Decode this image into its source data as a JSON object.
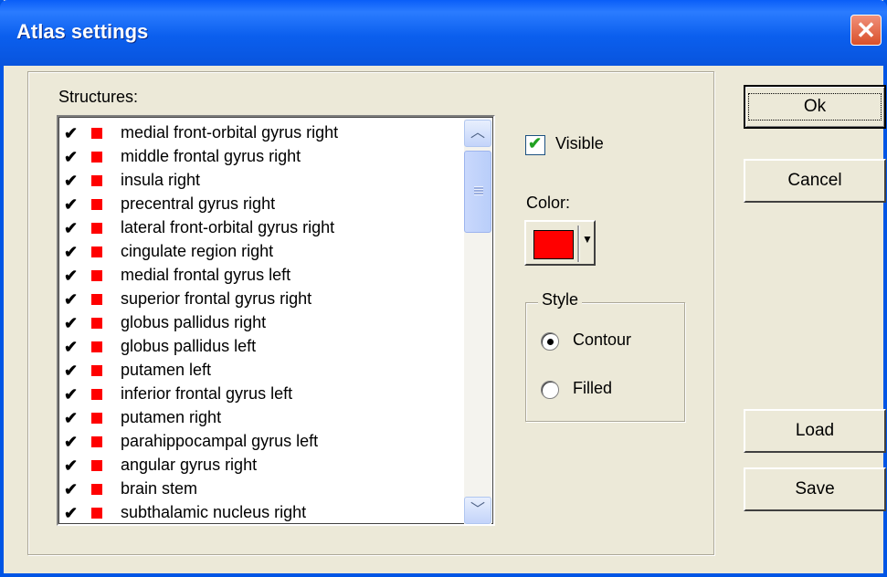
{
  "window": {
    "title": "Atlas settings"
  },
  "structures": {
    "label": "Structures:",
    "items": [
      {
        "name": "medial front-orbital gyrus right",
        "checked": true,
        "color": "#ff0000"
      },
      {
        "name": "middle frontal gyrus right",
        "checked": true,
        "color": "#ff0000"
      },
      {
        "name": "insula right",
        "checked": true,
        "color": "#ff0000"
      },
      {
        "name": "precentral gyrus right",
        "checked": true,
        "color": "#ff0000"
      },
      {
        "name": "lateral front-orbital gyrus right",
        "checked": true,
        "color": "#ff0000"
      },
      {
        "name": "cingulate region right",
        "checked": true,
        "color": "#ff0000"
      },
      {
        "name": "medial frontal gyrus left",
        "checked": true,
        "color": "#ff0000"
      },
      {
        "name": "superior frontal gyrus right",
        "checked": true,
        "color": "#ff0000"
      },
      {
        "name": "globus pallidus right",
        "checked": true,
        "color": "#ff0000"
      },
      {
        "name": "globus pallidus left",
        "checked": true,
        "color": "#ff0000"
      },
      {
        "name": "putamen left",
        "checked": true,
        "color": "#ff0000"
      },
      {
        "name": "inferior frontal gyrus left",
        "checked": true,
        "color": "#ff0000"
      },
      {
        "name": "putamen right",
        "checked": true,
        "color": "#ff0000"
      },
      {
        "name": "parahippocampal gyrus left",
        "checked": true,
        "color": "#ff0000"
      },
      {
        "name": "angular gyrus right",
        "checked": true,
        "color": "#ff0000"
      },
      {
        "name": "brain stem",
        "checked": true,
        "color": "#ff0000"
      },
      {
        "name": "subthalamic nucleus right",
        "checked": true,
        "color": "#ff0000"
      }
    ]
  },
  "visible": {
    "label": "Visible",
    "checked": true
  },
  "color": {
    "label": "Color:",
    "value": "#ff0000"
  },
  "style": {
    "legend": "Style",
    "options": [
      {
        "label": "Contour",
        "selected": true
      },
      {
        "label": "Filled",
        "selected": false
      }
    ]
  },
  "buttons": {
    "ok": "Ok",
    "cancel": "Cancel",
    "load": "Load",
    "save": "Save"
  },
  "icons": {
    "close": "close-icon",
    "check": "checkmark-icon",
    "dropdown": "chevron-down-icon"
  }
}
